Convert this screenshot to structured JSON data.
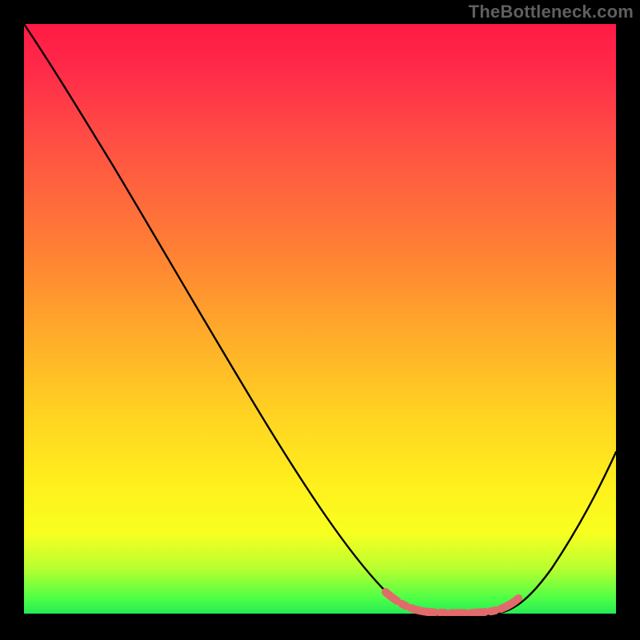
{
  "attribution": "TheBottleneck.com",
  "chart_data": {
    "type": "line",
    "title": "",
    "xlabel": "",
    "ylabel": "",
    "x": [
      0.0,
      0.05,
      0.1,
      0.15,
      0.2,
      0.25,
      0.3,
      0.35,
      0.4,
      0.45,
      0.5,
      0.55,
      0.6,
      0.64,
      0.68,
      0.72,
      0.76,
      0.8,
      0.82,
      0.86,
      0.9,
      0.94,
      0.98,
      1.0
    ],
    "values": [
      1.0,
      0.93,
      0.85,
      0.76,
      0.67,
      0.58,
      0.49,
      0.4,
      0.31,
      0.23,
      0.15,
      0.09,
      0.04,
      0.015,
      0.005,
      0.0,
      0.0,
      0.0,
      0.005,
      0.02,
      0.07,
      0.14,
      0.23,
      0.28
    ],
    "xlim": [
      0,
      1
    ],
    "ylim": [
      0,
      1
    ],
    "minimum_band": {
      "x_start": 0.64,
      "x_end": 0.83
    },
    "background_gradient": {
      "top": "#ff1a45",
      "mid": "#ffd322",
      "bottom": "#20e858"
    },
    "curve_color": "#000000",
    "highlight_color": "#e16b6b"
  }
}
